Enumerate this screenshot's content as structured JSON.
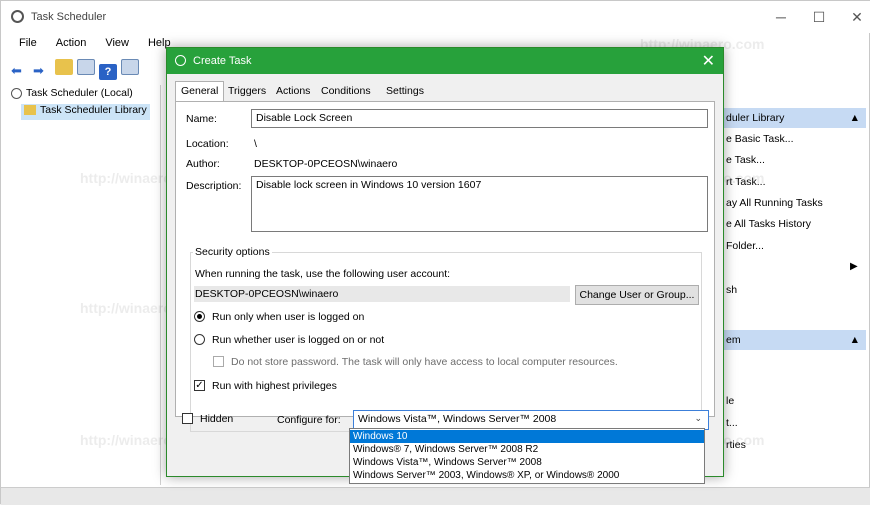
{
  "main": {
    "title": "Task Scheduler",
    "menu": [
      "File",
      "Action",
      "View",
      "Help"
    ],
    "tree": [
      "Task Scheduler (Local)",
      "Task Scheduler Library"
    ],
    "right_pane": {
      "section1": "duler Library",
      "items1": [
        "e Basic Task...",
        "e Task...",
        "rt Task...",
        "ay All Running Tasks",
        "e All Tasks History",
        "Folder...",
        "sh"
      ],
      "section2": "em",
      "items2": [
        "le",
        "t...",
        "rties"
      ]
    }
  },
  "dialog": {
    "title": "Create Task",
    "tabs": [
      "General",
      "Triggers",
      "Actions",
      "Conditions",
      "Settings"
    ],
    "name_label": "Name:",
    "name_value": "Disable Lock Screen",
    "location_label": "Location:",
    "location_value": "\\",
    "author_label": "Author:",
    "author_value": "DESKTOP-0PCEOSN\\winaero",
    "description_label": "Description:",
    "description_value": "Disable lock screen in Windows 10 version 1607",
    "security_title": "Security options",
    "security_text": "When running the task, use the following user account:",
    "account": "DESKTOP-0PCEOSN\\winaero",
    "change_button": "Change User or Group...",
    "radio1": "Run only when user is logged on",
    "radio2": "Run whether user is logged on or not",
    "no_store_password": "Do not store password.  The task will only have access to local computer resources.",
    "highest_privileges": "Run with highest privileges",
    "hidden": "Hidden",
    "configure_label": "Configure for:",
    "configure_value": "Windows Vista™, Windows Server™ 2008",
    "options": [
      "Windows 10",
      "Windows® 7, Windows Server™ 2008 R2",
      "Windows Vista™, Windows Server™ 2008",
      "Windows Server™ 2003, Windows® XP, or Windows® 2000"
    ]
  },
  "watermark": "http://winaero.com"
}
